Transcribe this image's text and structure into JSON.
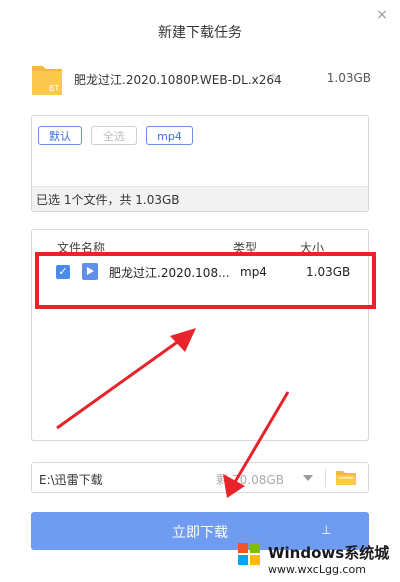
{
  "dialog": {
    "title": "新建下载任务",
    "close_icon": "×"
  },
  "torrent": {
    "badge": "BT",
    "name": "肥龙过江.2020.1080P.WEB-DL.x264",
    "size": "1.03GB",
    "icon": "bt-folder-icon"
  },
  "filters": {
    "chips": [
      "默认",
      "全选",
      "mp4"
    ],
    "summary": "已选 1个文件，共 1.03GB"
  },
  "file_list": {
    "headers": {
      "name": "文件名称",
      "type": "类型",
      "size": "大小"
    },
    "rows": [
      {
        "checked": true,
        "name": "肥龙过江.2020.108...",
        "type": "mp4",
        "size": "1.03GB"
      }
    ]
  },
  "save_path": {
    "path": "E:\\迅雷下载",
    "free": "剩:70.08GB"
  },
  "download": {
    "label": "立即下载",
    "speed_icon": "⊥"
  },
  "watermark": {
    "title": "Windows系统城",
    "url": "www.wxcLgg.com"
  },
  "colors": {
    "accent": "#6f9cf0",
    "highlight": "#e8232a",
    "arrow": "#e8232a"
  }
}
